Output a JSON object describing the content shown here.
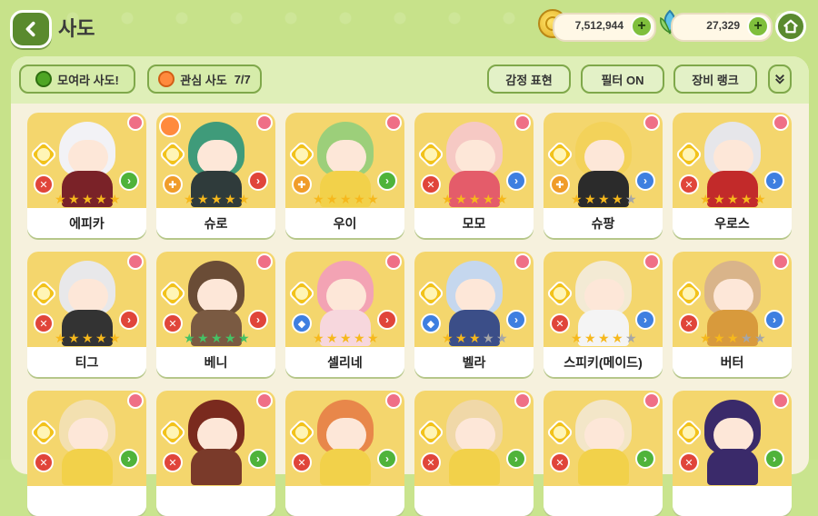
{
  "header": {
    "title": "사도",
    "gold_value": "7,512,944",
    "gem_value": "27,329"
  },
  "toolbar": {
    "gather_label": "모여라 사도!",
    "interest_label": "관심 사도",
    "interest_count": "7/7",
    "emotion_label": "감정 표현",
    "filter_label": "필터 ON",
    "equip_label": "장비 랭크"
  },
  "colors": {
    "element_light": "#f2c21b",
    "class_red": "#e0453a",
    "class_orange": "#f09c2a",
    "class_blue": "#3e7fe0",
    "pos_green": "#4fb33a",
    "pos_red": "#e0453a",
    "pos_blue": "#3e7fe0",
    "star_gold": "#f6b81c",
    "star_green": "#46c265",
    "star_gray": "#a6a6a6"
  },
  "cards": [
    {
      "name": "에피카",
      "stars": [
        "gold",
        "gold",
        "gold",
        "gold",
        "gold"
      ],
      "cls": "red",
      "pos": "green",
      "hair": "#f2f2f6",
      "body": "#7a2228",
      "heart": false
    },
    {
      "name": "슈로",
      "stars": [
        "gold",
        "gold",
        "gold",
        "gold",
        "gold"
      ],
      "cls": "orange",
      "pos": "red",
      "hair": "#3f9b7a",
      "body": "#2f3b3b",
      "heart": true
    },
    {
      "name": "우이",
      "stars": [
        "gold",
        "gold",
        "gold",
        "gold",
        "gold"
      ],
      "cls": "orange",
      "pos": "green",
      "hair": "#9ccf7a",
      "body": "#f2d14a",
      "heart": false
    },
    {
      "name": "모모",
      "stars": [
        "gold",
        "gold",
        "gold",
        "gold",
        "gold"
      ],
      "cls": "red",
      "pos": "blue",
      "hair": "#f6c9c4",
      "body": "#e45c6a",
      "heart": false
    },
    {
      "name": "슈팡",
      "stars": [
        "gold",
        "gold",
        "gold",
        "gold",
        "gray"
      ],
      "cls": "orange",
      "pos": "blue",
      "hair": "#f3d25a",
      "body": "#2b2b2b",
      "heart": false
    },
    {
      "name": "우로스",
      "stars": [
        "gold",
        "gold",
        "gold",
        "gold",
        "gold"
      ],
      "cls": "red",
      "pos": "blue",
      "hair": "#e6e6ea",
      "body": "#c22a2a",
      "heart": false
    },
    {
      "name": "티그",
      "stars": [
        "gold",
        "gold",
        "gold",
        "gold",
        "gold"
      ],
      "cls": "red",
      "pos": "red",
      "hair": "#e8e8ea",
      "body": "#333333",
      "heart": false
    },
    {
      "name": "베니",
      "stars": [
        "green",
        "green",
        "green",
        "green",
        "green"
      ],
      "cls": "red",
      "pos": "red",
      "hair": "#6a4c36",
      "body": "#7a5a42",
      "heart": false
    },
    {
      "name": "셀리네",
      "stars": [
        "gold",
        "gold",
        "gold",
        "gold",
        "gold"
      ],
      "cls": "blue",
      "pos": "red",
      "hair": "#f3a3b4",
      "body": "#f7d7dd",
      "heart": false
    },
    {
      "name": "벨라",
      "stars": [
        "gold",
        "gold",
        "gold",
        "gray",
        "gray"
      ],
      "cls": "blue",
      "pos": "blue",
      "hair": "#c5d7ee",
      "body": "#3b4e88",
      "heart": false
    },
    {
      "name": "스피키(메이드)",
      "stars": [
        "gold",
        "gold",
        "gold",
        "gold",
        "gray"
      ],
      "cls": "red",
      "pos": "blue",
      "hair": "#f3ead4",
      "body": "#f4f4f4",
      "heart": false
    },
    {
      "name": "버터",
      "stars": [
        "gold",
        "gold",
        "gold",
        "gray",
        "gray"
      ],
      "cls": "red",
      "pos": "blue",
      "hair": "#d9b48a",
      "body": "#d89a3c",
      "heart": false
    },
    {
      "name": "",
      "stars": [],
      "cls": "red",
      "pos": "green",
      "hair": "#f3e0b0",
      "body": "#f2d14a",
      "heart": false
    },
    {
      "name": "",
      "stars": [],
      "cls": "red",
      "pos": "green",
      "hair": "#7a2a1e",
      "body": "#7a3a2a",
      "heart": false
    },
    {
      "name": "",
      "stars": [],
      "cls": "red",
      "pos": "green",
      "hair": "#e8874a",
      "body": "#f2d14a",
      "heart": false
    },
    {
      "name": "",
      "stars": [],
      "cls": "red",
      "pos": "green",
      "hair": "#f0d8a8",
      "body": "#f2d14a",
      "heart": false
    },
    {
      "name": "",
      "stars": [],
      "cls": "red",
      "pos": "green",
      "hair": "#f3e6c8",
      "body": "#f2d14a",
      "heart": false
    },
    {
      "name": "",
      "stars": [],
      "cls": "red",
      "pos": "green",
      "hair": "#3a2a6a",
      "body": "#3a2a6a",
      "heart": false
    }
  ]
}
